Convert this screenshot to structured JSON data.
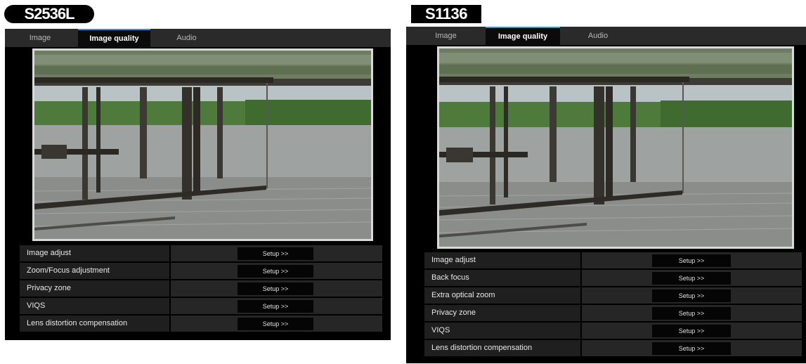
{
  "left": {
    "model_badge": "S2536L",
    "tabs": [
      {
        "label": "Image",
        "active": false
      },
      {
        "label": "Image quality",
        "active": true
      },
      {
        "label": "Audio",
        "active": false
      }
    ],
    "rows": [
      {
        "label": "Image adjust",
        "button": "Setup >>"
      },
      {
        "label": "Zoom/Focus adjustment",
        "button": "Setup >>"
      },
      {
        "label": "Privacy zone",
        "button": "Setup >>"
      },
      {
        "label": "VIQS",
        "button": "Setup >>"
      },
      {
        "label": "Lens distortion compensation",
        "button": "Setup >>"
      }
    ]
  },
  "right": {
    "model_badge": "S1136",
    "tabs": [
      {
        "label": "Image",
        "active": false
      },
      {
        "label": "Image quality",
        "active": true
      },
      {
        "label": "Audio",
        "active": false
      }
    ],
    "rows": [
      {
        "label": "Image adjust",
        "button": "Setup >>"
      },
      {
        "label": "Back focus",
        "button": "Setup >>"
      },
      {
        "label": "Extra optical zoom",
        "button": "Setup >>"
      },
      {
        "label": "Privacy zone",
        "button": "Setup >>"
      },
      {
        "label": "VIQS",
        "button": "Setup >>"
      },
      {
        "label": "Lens distortion compensation",
        "button": "Setup >>"
      }
    ]
  },
  "colors": {
    "panel_bg": "#000000",
    "tab_bar": "#2a2a2a",
    "active_tab_indicator": "#3e8edb",
    "row_label_bg": "#1f1f1f",
    "setup_button_bg": "#050505"
  }
}
